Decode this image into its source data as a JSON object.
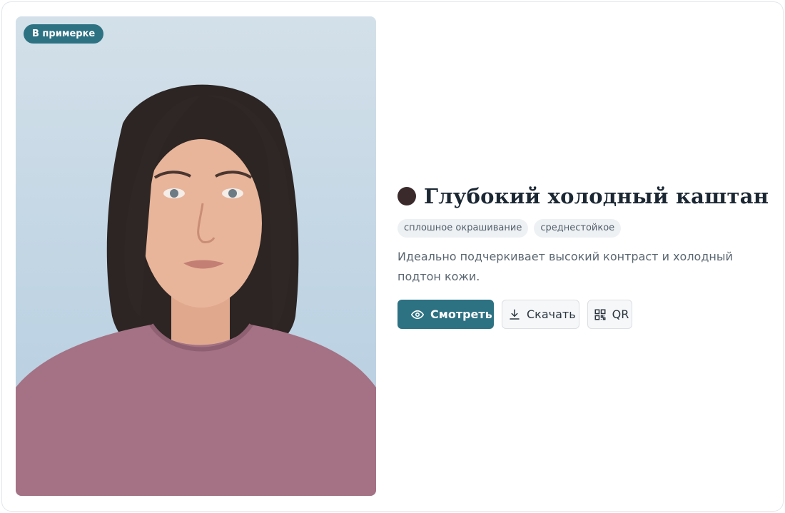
{
  "photo": {
    "badge": "В примерке"
  },
  "shade": {
    "color": "#3a2a2b",
    "title": "Глубокий холодный каштан",
    "tags": [
      "сплошное окрашивание",
      "среднестойкое"
    ],
    "description": "Идеально подчеркивает высокий контраст и холодный подтон кожи."
  },
  "actions": {
    "view_label": "Смотреть",
    "view_icon": "eye-icon",
    "download_label": "Скачать",
    "download_icon": "download-icon",
    "qr_label": "QR",
    "qr_icon": "qr-code-icon"
  },
  "colors": {
    "accent": "#2d7283",
    "tag_background": "#eef1f4"
  }
}
